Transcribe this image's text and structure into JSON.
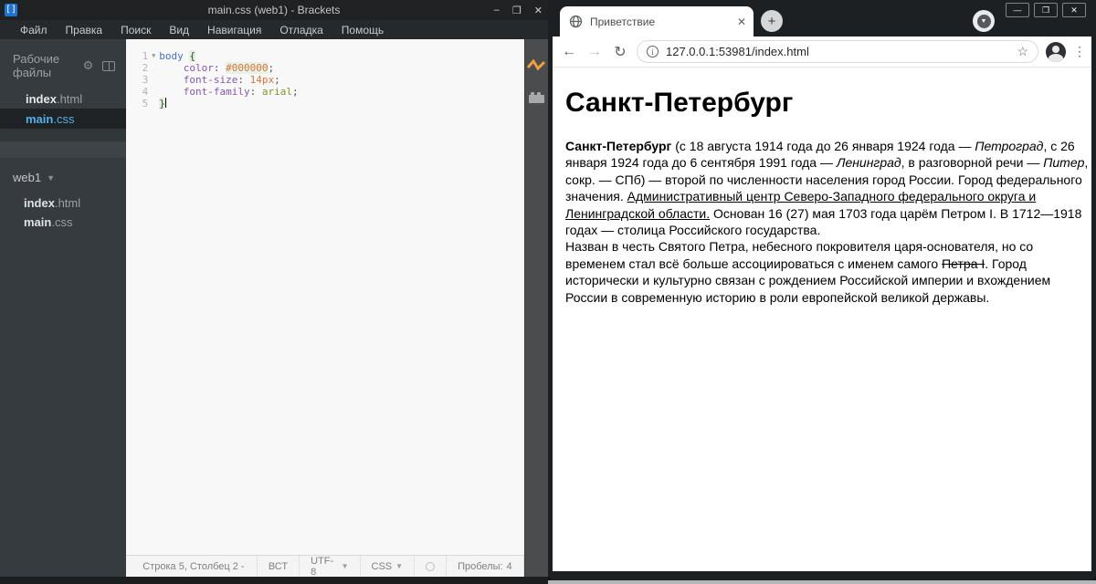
{
  "editor": {
    "title": "main.css (web1) - Brackets",
    "window_controls": {
      "minimize": "–",
      "maximize": "❐",
      "close": "✕"
    },
    "menu": [
      "Файл",
      "Правка",
      "Поиск",
      "Вид",
      "Навигация",
      "Отладка",
      "Помощь"
    ],
    "sidebar": {
      "working_files_label": "Рабочие файлы",
      "working_files": [
        {
          "name": "index",
          "ext": ".html",
          "selected": false
        },
        {
          "name": "main",
          "ext": ".css",
          "selected": true
        }
      ],
      "project_name": "web1",
      "project_files": [
        {
          "name": "index",
          "ext": ".html"
        },
        {
          "name": "main",
          "ext": ".css"
        }
      ]
    },
    "code": {
      "lines": [
        {
          "num": "1",
          "fold": "▼",
          "segments": [
            {
              "t": "body ",
              "c": "tag"
            },
            {
              "t": "{",
              "c": "brace"
            }
          ]
        },
        {
          "num": "2",
          "segments": [
            {
              "t": "    ",
              "c": "plain"
            },
            {
              "t": "color",
              "c": "prop"
            },
            {
              "t": ": ",
              "c": "punct"
            },
            {
              "t": "#000000",
              "c": "hex"
            },
            {
              "t": ";",
              "c": "punct"
            }
          ]
        },
        {
          "num": "3",
          "segments": [
            {
              "t": "    ",
              "c": "plain"
            },
            {
              "t": "font-size",
              "c": "prop"
            },
            {
              "t": ": ",
              "c": "punct"
            },
            {
              "t": "14px",
              "c": "orange"
            },
            {
              "t": ";",
              "c": "punct"
            }
          ]
        },
        {
          "num": "4",
          "segments": [
            {
              "t": "    ",
              "c": "plain"
            },
            {
              "t": "font-family",
              "c": "prop"
            },
            {
              "t": ": ",
              "c": "punct"
            },
            {
              "t": "arial",
              "c": "green"
            },
            {
              "t": ";",
              "c": "punct"
            }
          ]
        },
        {
          "num": "5",
          "segments": [
            {
              "t": "}",
              "c": "brace"
            },
            {
              "caret": true
            }
          ]
        }
      ]
    },
    "statusbar": {
      "position": "Строка 5, Столбец 2 -",
      "insert_mode": "ВСТ",
      "encoding": "UTF-8",
      "language": "CSS",
      "spaces_label": "Пробелы:",
      "spaces_value": "4"
    },
    "icons": {
      "live_preview": "lightning-zigzag",
      "extension_manager": "lego-brick",
      "settings": "⚙"
    },
    "colors": {
      "live_preview_accent": "#f0a13c",
      "selected_file_text": "#55aee8",
      "sidebar_bg": "#363b3f"
    }
  },
  "browser": {
    "tab_title": "Приветствие",
    "new_tab_glyph": "+",
    "tab_close_glyph": "✕",
    "window_controls": {
      "minimize": "—",
      "maximize": "❐",
      "close": "✕"
    },
    "nav": {
      "back": "←",
      "forward": "→",
      "reload": "↻"
    },
    "url": "127.0.0.1:53981/index.html",
    "page": {
      "heading": "Санкт-Петербург",
      "paragraph_segments": [
        {
          "t": "Санкт-Петербург",
          "b": true
        },
        {
          "t": " (с 18 августа 1914 года до 26 января 1924 года — "
        },
        {
          "t": "Петроград",
          "i": true
        },
        {
          "t": ", с 26 января 1924 года до 6 сентября 1991 года — "
        },
        {
          "t": "Ленинград",
          "i": true
        },
        {
          "t": ", в разговорной речи — "
        },
        {
          "t": "Питер",
          "i": true
        },
        {
          "t": ", сокр. — СПб) — второй по численности населения город России. Город федерального значения. "
        },
        {
          "t": "Административный центр Северо-Западного федерального округа и Ленинградской области.",
          "u": true
        },
        {
          "t": " Основан 16 (27) мая 1703 года царём Петром I. В 1712—1918 годах — столица Российского государства."
        },
        {
          "br": true
        },
        {
          "t": "Назван в честь Святого Петра, небесного покровителя царя-основателя, но со временем стал всё больше ассоциироваться с именем самого "
        },
        {
          "t": "Петра I",
          "s": true
        },
        {
          "t": ". Город исторически и культурно связан с рождением Российской империи и вхождением России в современную историю в роли европейской великой державы."
        }
      ]
    }
  }
}
